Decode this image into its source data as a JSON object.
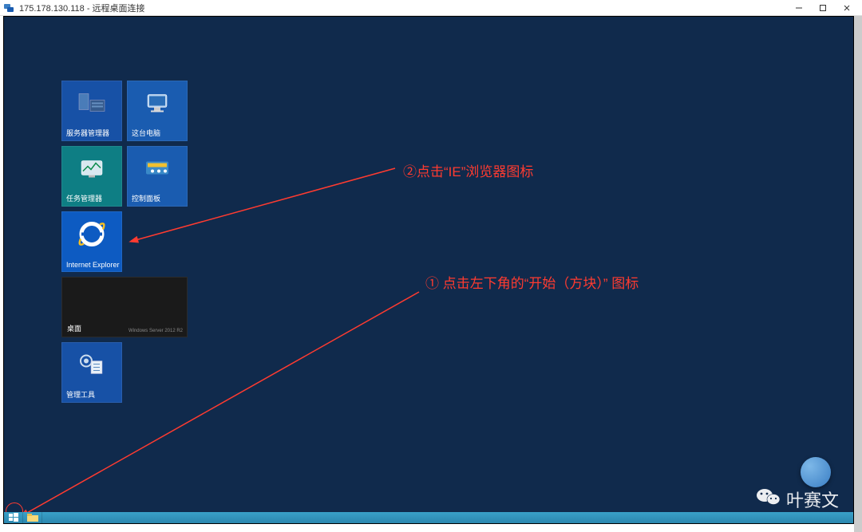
{
  "window": {
    "title": "175.178.130.118 - 远程桌面连接"
  },
  "tiles": {
    "server_manager": "服务器管理器",
    "this_pc": "这台电脑",
    "task_manager": "任务管理器",
    "control_panel": "控制面板",
    "internet_explorer": "Internet Explorer",
    "desktop": "桌面",
    "desktop_watermark": "Windows Server 2012 R2",
    "admin_tools": "管理工具"
  },
  "annotations": {
    "ie_hint": "②点击“IE”浏览器图标",
    "start_hint": "① 点击左下角的“开始（方块）” 图标"
  },
  "watermark": {
    "author": "叶赛文"
  }
}
